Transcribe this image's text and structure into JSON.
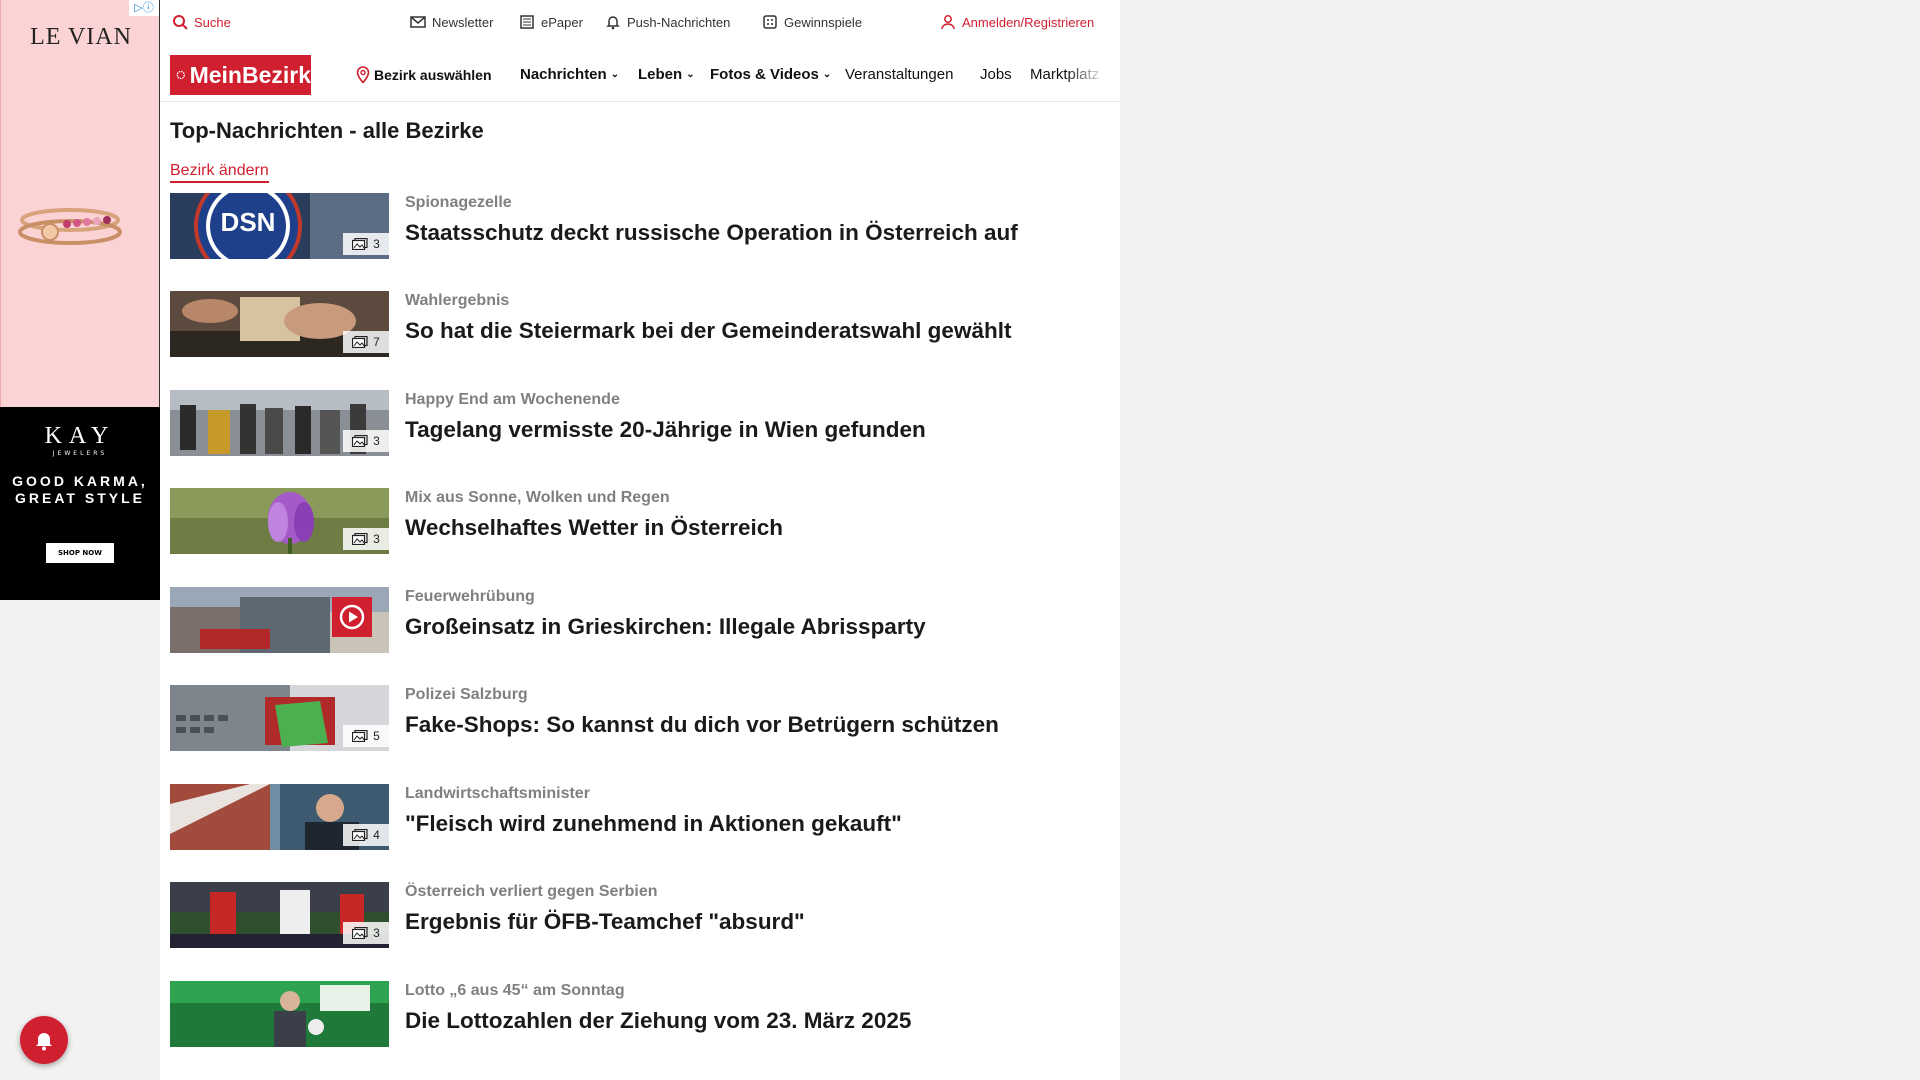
{
  "ads": {
    "top": {
      "brand": "LE VIAN",
      "adchoice": "▷ⓘ"
    },
    "bottom": {
      "brand": "KAY",
      "brand_sub": "JEWELERS",
      "slogan_line1": "GOOD KARMA,",
      "slogan_line2": "GREAT STYLE",
      "cta": "SHOP NOW"
    }
  },
  "topbar": {
    "search": "Suche",
    "newsletter": "Newsletter",
    "epaper": "ePaper",
    "push": "Push-Nachrichten",
    "gewinnspiele": "Gewinnspiele",
    "login": "Anmelden/Registrieren"
  },
  "nav": {
    "logo": "MeinBezirk",
    "select_district": "Bezirk auswählen",
    "items": [
      "Nachrichten",
      "Leben",
      "Fotos & Videos",
      "Veranstaltungen",
      "Jobs",
      "Marktplatz"
    ]
  },
  "page": {
    "title": "Top-Nachrichten - alle Bezirke",
    "change_link": "Bezirk ändern"
  },
  "articles": [
    {
      "kicker": "Spionagezelle",
      "headline": "Staatsschutz deckt russische Operation in Österreich auf",
      "count": "3",
      "media": "gallery"
    },
    {
      "kicker": "Wahlergebnis",
      "headline": "So hat die Steiermark bei der Gemeinderatswahl gewählt",
      "count": "7",
      "media": "gallery"
    },
    {
      "kicker": "Happy End am Wochenende",
      "headline": "Tagelang vermisste 20-Jährige in Wien gefunden",
      "count": "3",
      "media": "gallery"
    },
    {
      "kicker": "Mix aus Sonne, Wolken und Regen",
      "headline": "Wechselhaftes Wetter in Österreich",
      "count": "3",
      "media": "gallery"
    },
    {
      "kicker": "Feuerwehrübung",
      "headline": "Großeinsatz in Grieskirchen: Illegale Abrissparty",
      "count": "",
      "media": "video"
    },
    {
      "kicker": "Polizei Salzburg",
      "headline": "Fake-Shops: So kannst du dich vor Betrügern schützen",
      "count": "5",
      "media": "gallery"
    },
    {
      "kicker": "Landwirtschaftsminister",
      "headline": "\"Fleisch wird zunehmend in Aktionen gekauft\"",
      "count": "4",
      "media": "gallery"
    },
    {
      "kicker": "Österreich verliert gegen Serbien",
      "headline": "Ergebnis für ÖFB-Teamchef \"absurd\"",
      "count": "3",
      "media": "gallery"
    },
    {
      "kicker": "Lotto „6 aus 45“ am Sonntag",
      "headline": "Die Lottozahlen der Ziehung vom 23. März 2025",
      "count": "",
      "media": "none"
    }
  ],
  "colors": {
    "brand": "#d01f2f",
    "kicker": "#808080"
  },
  "icons": [
    "search-icon",
    "mail-icon",
    "newspaper-icon",
    "bell-icon",
    "gift-icon",
    "user-icon",
    "location-pin-icon",
    "chevron-down-icon",
    "gallery-icon",
    "play-icon"
  ]
}
